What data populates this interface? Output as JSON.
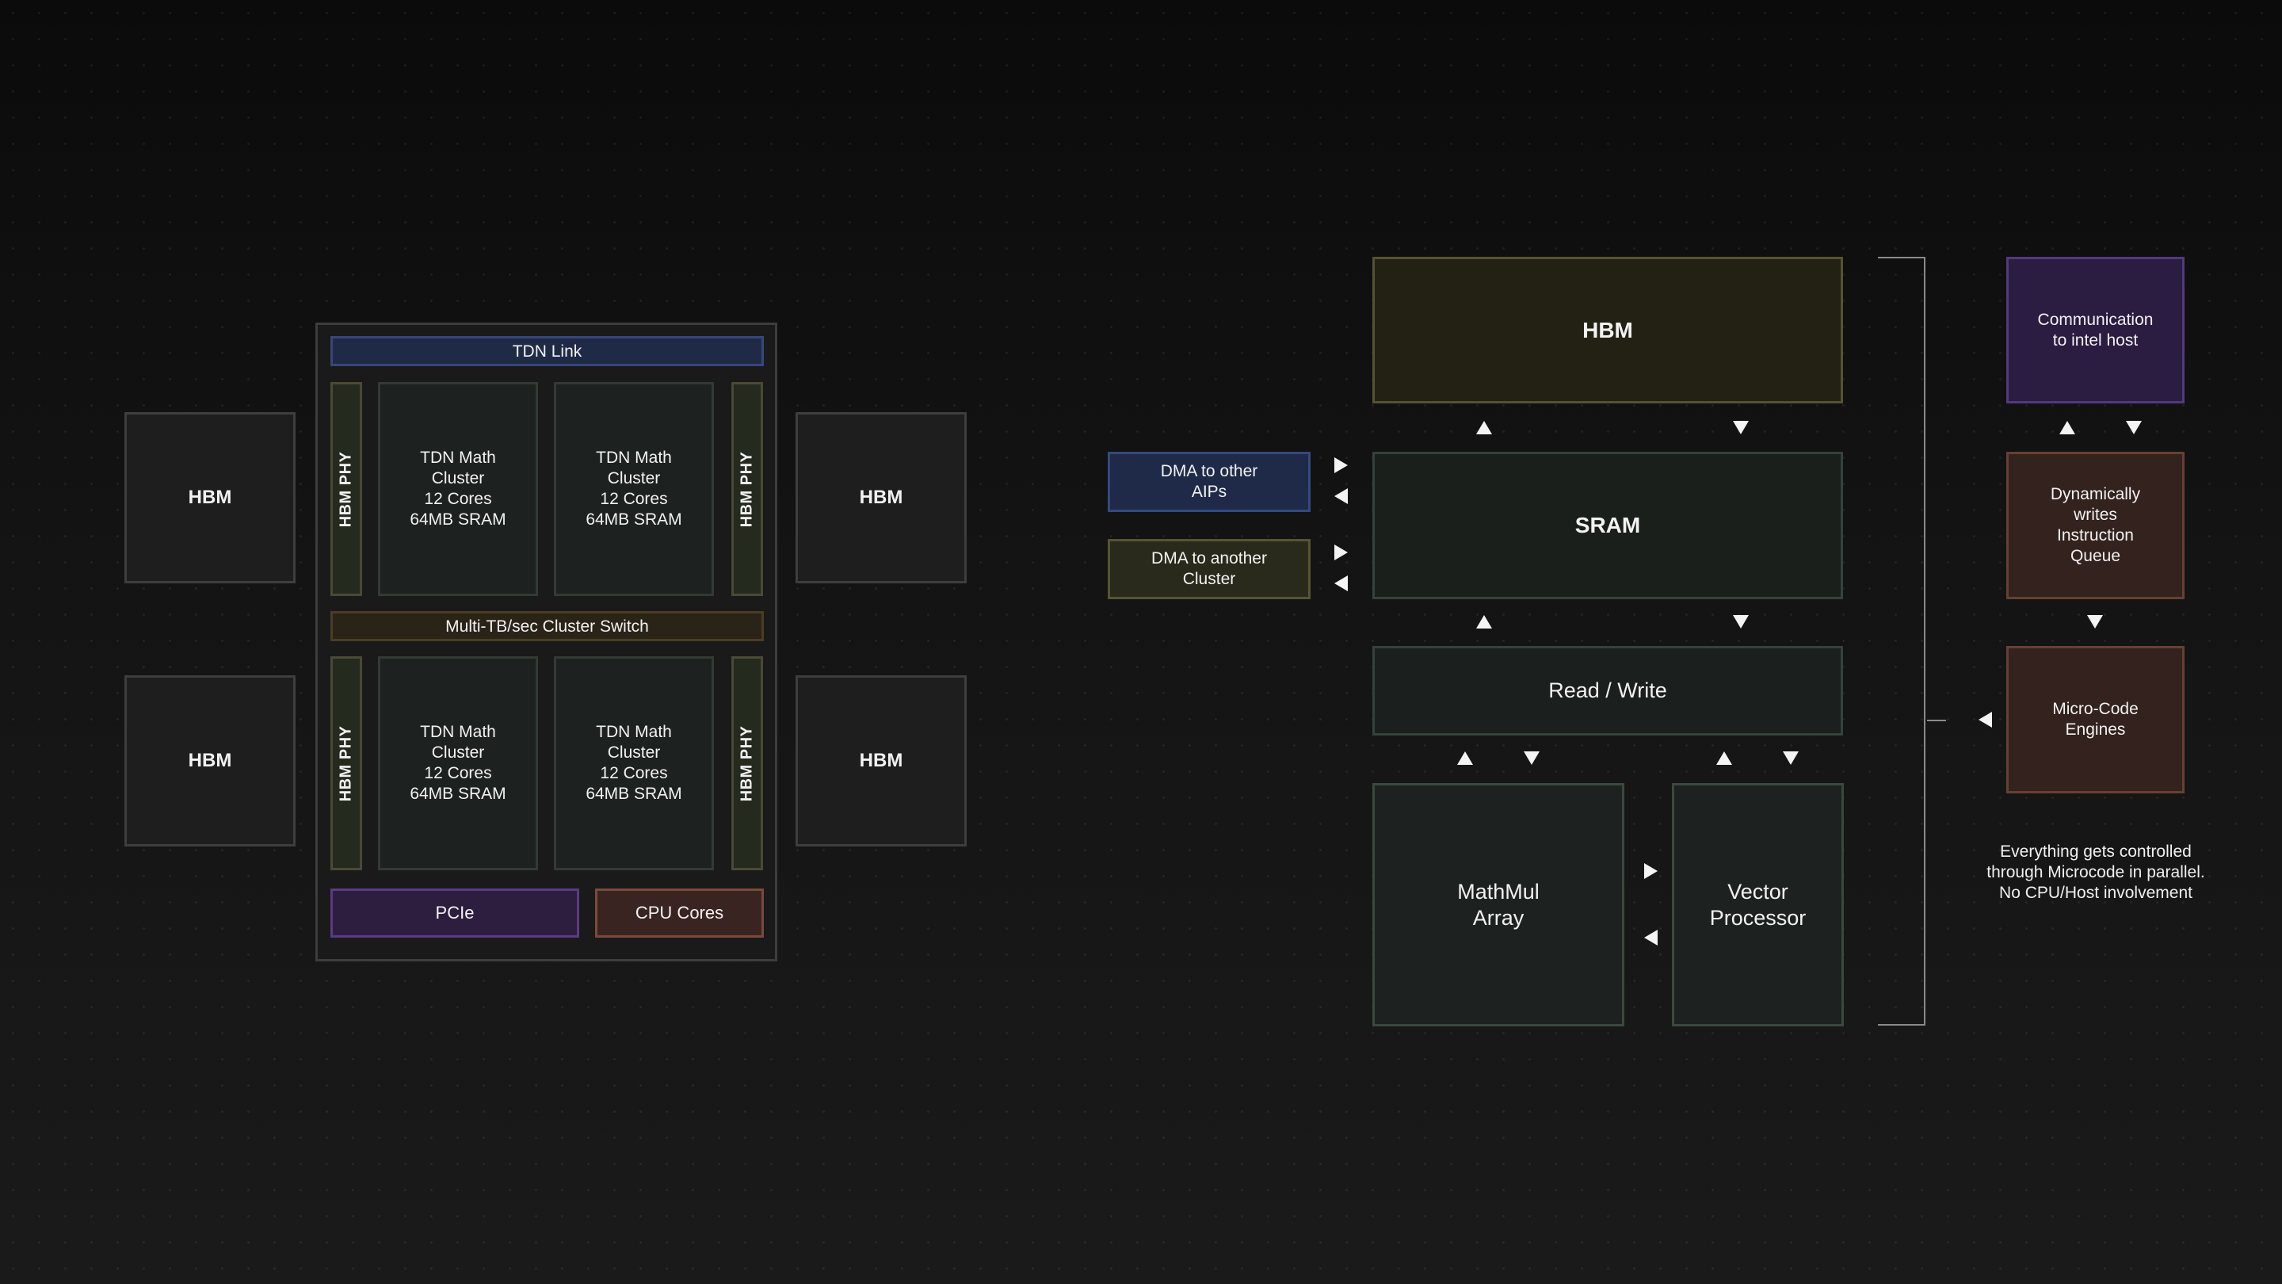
{
  "left_diagram": {
    "outer_hbm": {
      "top_left": "HBM",
      "bottom_left": "HBM",
      "top_right": "HBM",
      "bottom_right": "HBM"
    },
    "chip": {
      "tdn_link": "TDN Link",
      "cluster_switch": "Multi-TB/sec Cluster Switch",
      "hbm_phy": "HBM PHY",
      "clusters": [
        "TDN Math\nCluster\n12 Cores\n64MB SRAM",
        "TDN Math\nCluster\n12 Cores\n64MB SRAM",
        "TDN Math\nCluster\n12 Cores\n64MB SRAM",
        "TDN Math\nCluster\n12 Cores\n64MB SRAM"
      ],
      "pcie": "PCIe",
      "cpu_cores": "CPU Cores"
    }
  },
  "right_diagram": {
    "dma_aips": "DMA to other\nAIPs",
    "dma_cluster": "DMA to another\nCluster",
    "hbm": "HBM",
    "sram": "SRAM",
    "read_write": "Read / Write",
    "mathmul": "MathMul\nArray",
    "vector": "Vector\nProcessor"
  },
  "control": {
    "communication": "Communication\nto intel host",
    "dynamic_queue": "Dynamically\nwrites\nInstruction\nQueue",
    "microcode": "Micro-Code\nEngines",
    "note": "Everything gets controlled\nthrough Microcode in parallel.\nNo CPU/Host involvement"
  },
  "colors": {
    "background": "#121212",
    "tdn_link": "#1f2b46",
    "pcie": "#2d1e3f",
    "cpu_cores": "#3a2421",
    "hbm_big": "#222114",
    "communication": "#2b1c41",
    "microcode": "#33221d"
  }
}
